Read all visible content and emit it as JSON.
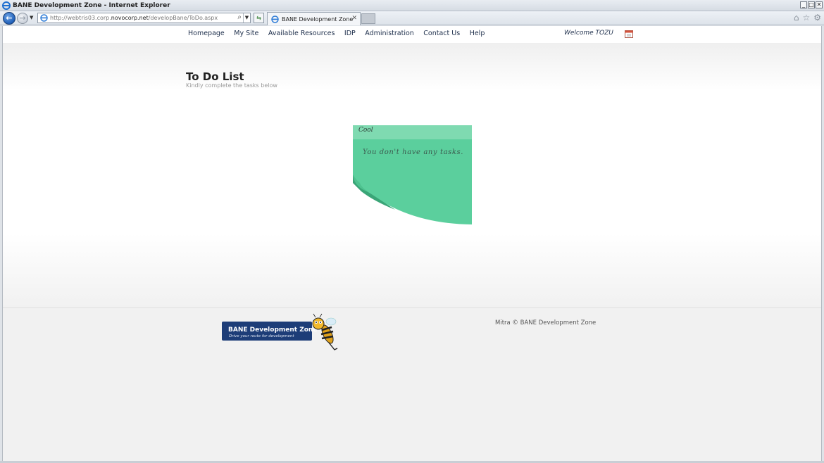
{
  "window": {
    "title": "BANE Development Zone - Internet Explorer",
    "controls": [
      "_",
      "□",
      "✕"
    ]
  },
  "browser": {
    "url_prefix": "http://webtris03.corp.",
    "url_domain": "novocorp.net",
    "url_path": "/developBane/ToDo.aspx",
    "tab_label": "BANE Development Zone"
  },
  "nav": {
    "items": [
      {
        "label": "Homepage"
      },
      {
        "label": "My Site"
      },
      {
        "label": "Available Resources"
      },
      {
        "label": "IDP"
      },
      {
        "label": "Administration"
      },
      {
        "label": "Contact Us"
      },
      {
        "label": "Help"
      }
    ],
    "welcome": "Welcome  TOZU"
  },
  "main": {
    "title": "To Do List",
    "subtitle": "Kindly complete the tasks below"
  },
  "note": {
    "header": "Cool",
    "message": "You don't have any tasks."
  },
  "footer": {
    "logo_title": "BANE Development Zone",
    "logo_tagline": "Drive your route for development",
    "copyright": "Mitra © BANE Development Zone"
  },
  "colors": {
    "note_green": "#5bcf9d",
    "note_header": "#7fdab1",
    "logo_blue": "#1d3d78"
  }
}
